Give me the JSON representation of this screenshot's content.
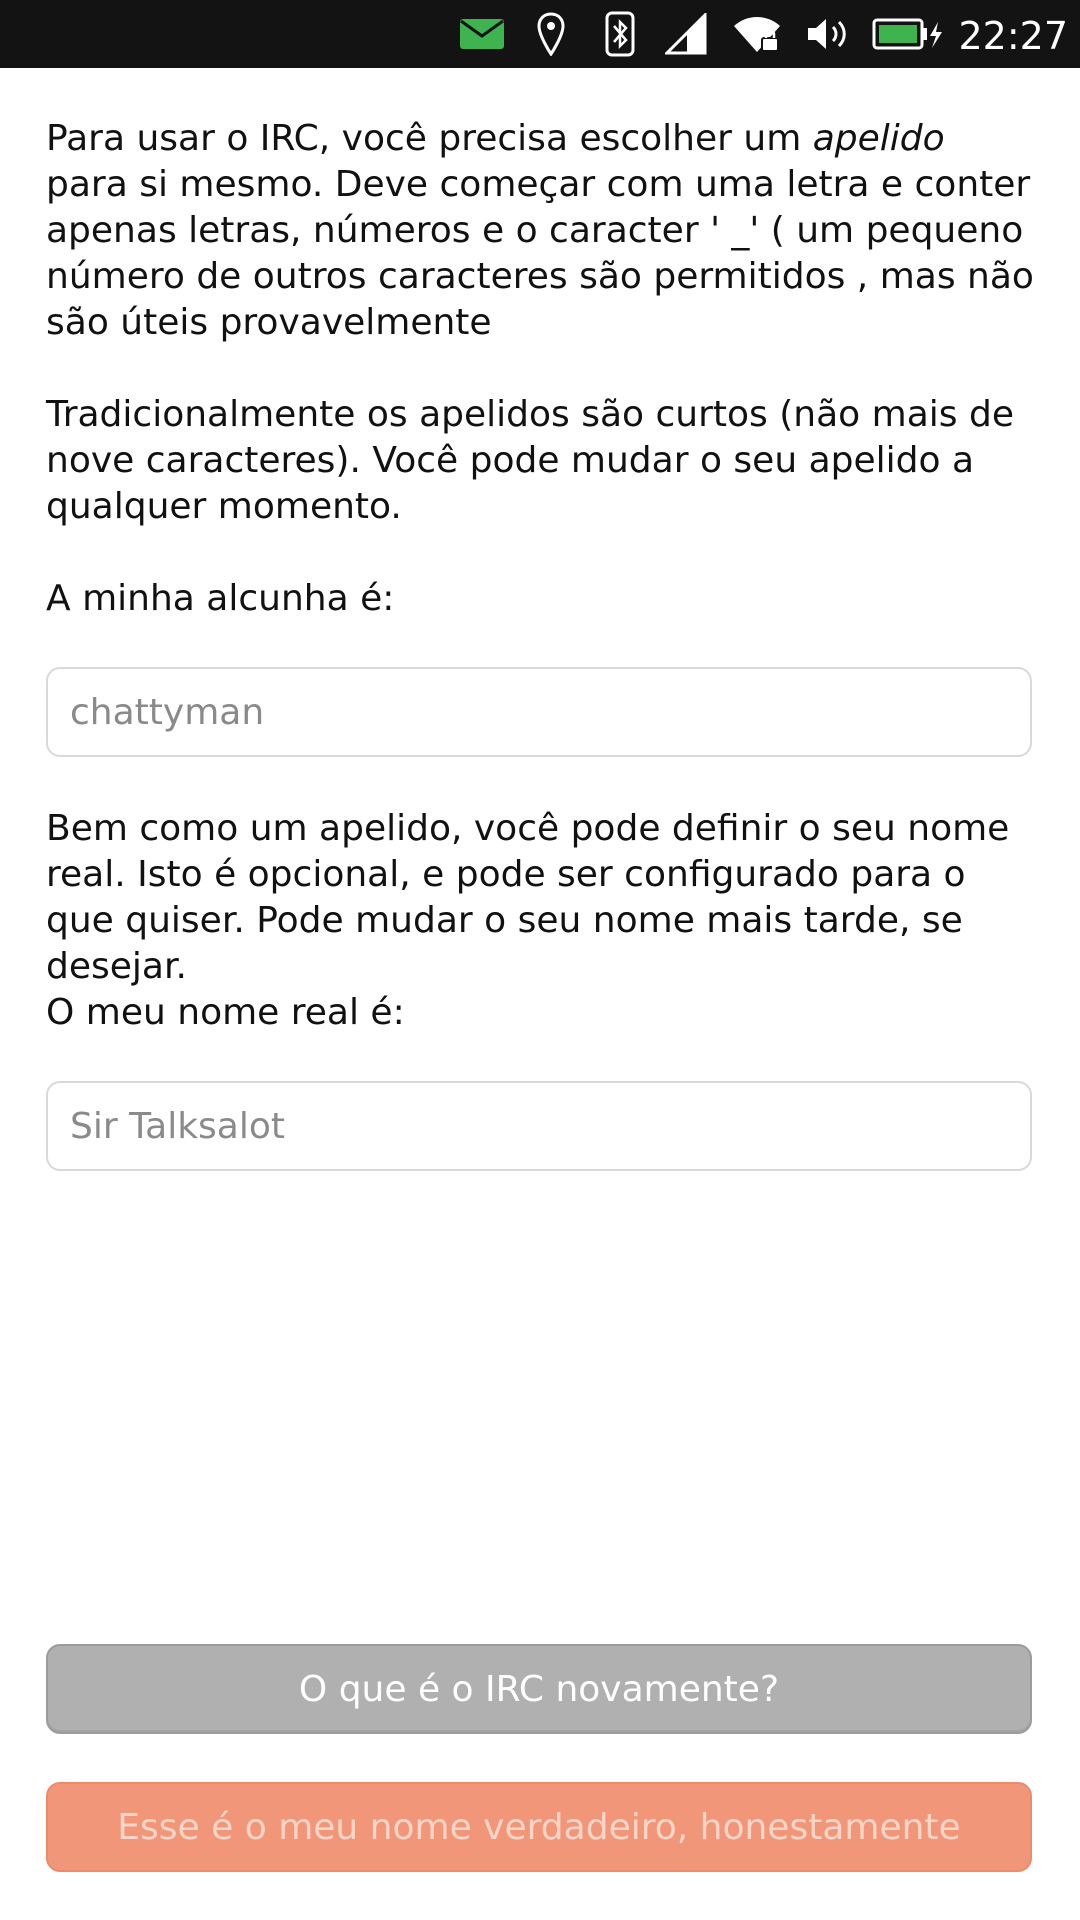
{
  "status_bar": {
    "time": "22:27",
    "icons": [
      "mail-icon",
      "location-pin-icon",
      "bluetooth-icon",
      "cellular-signal-icon",
      "wifi-locked-icon",
      "volume-icon",
      "battery-charging-icon"
    ],
    "mail_color": "#3eb34f"
  },
  "intro": {
    "part1": "Para usar o IRC, você precisa escolher um ",
    "emphasis": "apelido",
    "part2": " para si mesmo. Deve começar com uma letra e conter apenas letras, números e o caracter ' _' ( um pequeno número de outros caracteres são permitidos , mas não são úteis provavelmente"
  },
  "tradition_text": "Tradicionalmente os apelidos são curtos (não mais de nove caracteres). Você pode mudar o seu apelido a qualquer momento.",
  "nickname": {
    "label": "A minha alcunha é:",
    "placeholder": "chattyman",
    "value": ""
  },
  "realname_info": "Bem como um apelido, você pode definir o seu nome real. Isto é opcional, e pode ser configurado para o que quiser. Pode mudar o seu nome mais tarde, se desejar.",
  "realname": {
    "label": "O meu nome real é:",
    "placeholder": "Sir Talksalot",
    "value": ""
  },
  "buttons": {
    "what_is_irc": "O que é o IRC novamente?",
    "confirm": "Esse é o meu nome verdadeiro, honestamente"
  },
  "colors": {
    "accent_orange": "#f29679",
    "neutral_button": "#b0b0b0",
    "status_bar_bg": "#131313"
  }
}
